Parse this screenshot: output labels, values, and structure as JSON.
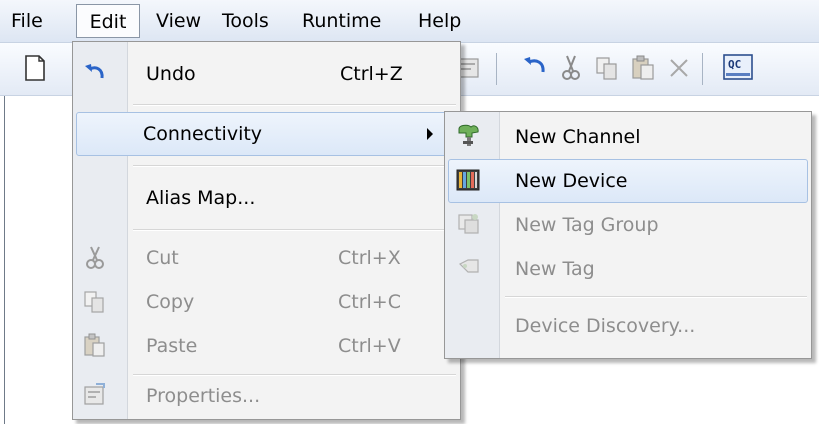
{
  "menubar": {
    "items": [
      {
        "label": "File"
      },
      {
        "label": "Edit"
      },
      {
        "label": "View"
      },
      {
        "label": "Tools"
      },
      {
        "label": "Runtime"
      },
      {
        "label": "Help"
      }
    ]
  },
  "toolbar": {
    "icons": [
      "new-file-icon",
      "undo-icon",
      "cut-icon",
      "copy-icon",
      "paste-icon",
      "delete-icon",
      "quick-client-icon"
    ],
    "qc_label": "QC"
  },
  "edit_menu": {
    "items": [
      {
        "label": "Undo",
        "shortcut": "Ctrl+Z",
        "icon": "undo-icon",
        "enabled": true
      },
      {
        "label": "Connectivity",
        "icon": null,
        "enabled": true,
        "highlighted": true,
        "submenu": true
      },
      {
        "label": "Alias Map...",
        "icon": null,
        "enabled": true
      },
      {
        "label": "Cut",
        "shortcut": "Ctrl+X",
        "icon": "cut-icon",
        "enabled": false
      },
      {
        "label": "Copy",
        "shortcut": "Ctrl+C",
        "icon": "copy-icon",
        "enabled": false
      },
      {
        "label": "Paste",
        "shortcut": "Ctrl+V",
        "icon": "paste-icon",
        "enabled": false
      },
      {
        "label": "Properties...",
        "icon": "properties-icon",
        "enabled": false
      }
    ]
  },
  "connectivity_submenu": {
    "items": [
      {
        "label": "New Channel",
        "icon": "new-channel-icon",
        "enabled": true
      },
      {
        "label": "New Device",
        "icon": "new-device-icon",
        "enabled": true,
        "highlighted": true
      },
      {
        "label": "New Tag Group",
        "icon": "new-tag-group-icon",
        "enabled": false
      },
      {
        "label": "New Tag",
        "icon": "new-tag-icon",
        "enabled": false
      },
      {
        "label": "Device Discovery...",
        "icon": null,
        "enabled": false
      }
    ]
  },
  "colors": {
    "highlight_border": "#a7c1e3",
    "highlight_fill": "#dce8f8",
    "disabled_text": "#8d8d8d",
    "menu_bg": "#f3f3f3"
  }
}
